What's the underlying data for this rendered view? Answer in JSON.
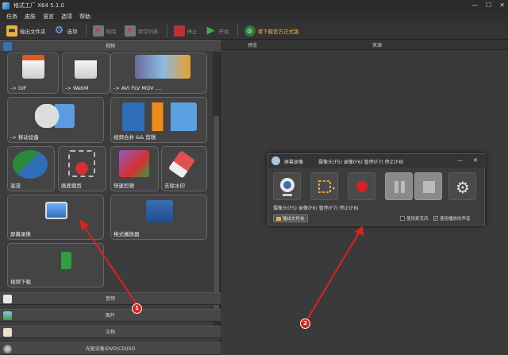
{
  "window": {
    "title": "格式工厂 X64 5.1.0",
    "controls": [
      "—",
      "☐",
      "✕"
    ]
  },
  "menu": [
    "任务",
    "皮肤",
    "语言",
    "选项",
    "帮助"
  ],
  "toolbar": {
    "output_folder": "输出文件夹",
    "options": "选项",
    "remove": "移除",
    "clear_list": "清空列表",
    "stop": "停止",
    "start": "开始",
    "download": "请下载官方正式版"
  },
  "sidebar": {
    "video_header": "视频",
    "tiles": [
      {
        "label": "-> GIF"
      },
      {
        "label": "-> WebM"
      },
      {
        "label": "-> AVI FLV MOV ...."
      },
      {
        "label": "-> 移动设备"
      },
      {
        "label": "视频合并 && 剪辑"
      },
      {
        "label": "混流"
      },
      {
        "label": "画面裁剪"
      },
      {
        "label": "快速剪辑"
      },
      {
        "label": "去除水印"
      },
      {
        "label": "屏幕录像"
      },
      {
        "label": "格式播放器"
      },
      {
        "label": "视频下载"
      }
    ],
    "categories": [
      {
        "label": "音频"
      },
      {
        "label": "图片"
      },
      {
        "label": "文档"
      },
      {
        "label": "光驱设备\\DVD\\CD\\ISO"
      }
    ]
  },
  "table": {
    "columns": [
      "预览",
      "来源"
    ]
  },
  "recorder_dialog": {
    "title": "屏幕录像",
    "hotkeys": "摄像头(F5)  录像(F6)  暂停(F7)  停止(F8)",
    "button_hotkeys": "摄像头(F5) 录像(F6) 暂停(F7) 停止(F8)",
    "output_folder": "输出文件夹",
    "use_microphone": "使用麦克风",
    "use_system_sound": "使用播放的声音",
    "use_microphone_checked": false,
    "use_system_sound_checked": true
  },
  "annotations": [
    {
      "label": "1"
    },
    {
      "label": "2"
    }
  ],
  "colors": {
    "accent_red": "#e02020",
    "download_orange": "#ffb040"
  }
}
